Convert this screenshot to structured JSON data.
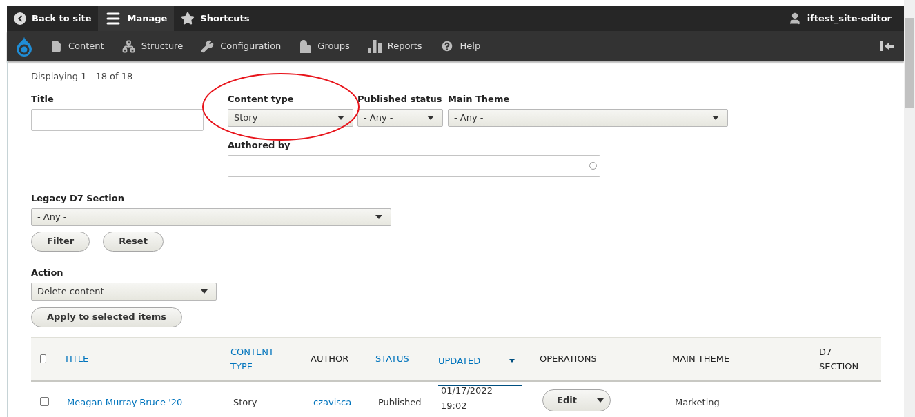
{
  "toolbar": {
    "tabs": [
      {
        "label": "Back to site",
        "kind": "back",
        "selected": false
      },
      {
        "label": "Manage",
        "kind": "menu",
        "selected": true
      },
      {
        "label": "Shortcuts",
        "kind": "star",
        "selected": false
      }
    ],
    "user": "iftest_site-editor"
  },
  "admin_menu": [
    {
      "label": "Content",
      "kind": "file"
    },
    {
      "label": "Structure",
      "kind": "structure"
    },
    {
      "label": "Configuration",
      "kind": "wrench"
    },
    {
      "label": "Groups",
      "kind": "groups"
    },
    {
      "label": "Reports",
      "kind": "reports"
    },
    {
      "label": "Help",
      "kind": "help"
    }
  ],
  "summary": "Displaying 1 - 18 of 18",
  "filters": {
    "title": {
      "label": "Title"
    },
    "content_type": {
      "label": "Content type",
      "value": "Story"
    },
    "published_status": {
      "label": "Published status",
      "value": "- Any -"
    },
    "main_theme": {
      "label": "Main Theme",
      "value": "- Any -"
    },
    "authored_by": {
      "label": "Authored by"
    },
    "legacy_section": {
      "label": "Legacy D7 Section",
      "value": "- Any -"
    },
    "buttons": [
      "Filter",
      "Reset"
    ]
  },
  "action": {
    "label": "Action",
    "value": "Delete content",
    "button": "Apply to selected items"
  },
  "table": {
    "select_all_checked": false,
    "columns": [
      {
        "label": "TITLE",
        "sortable": true,
        "sorted": false
      },
      {
        "label": "CONTENT TYPE",
        "sortable": true,
        "sorted": false
      },
      {
        "label": "AUTHOR",
        "sortable": false,
        "sorted": false
      },
      {
        "label": "STATUS",
        "sortable": true,
        "sorted": false
      },
      {
        "label": "UPDATED",
        "sortable": true,
        "sorted": true
      },
      {
        "label": "OPERATIONS",
        "sortable": false,
        "sorted": false
      },
      {
        "label": "MAIN THEME",
        "sortable": false,
        "sorted": false
      },
      {
        "label": "D7 SECTION",
        "sortable": false,
        "sorted": false
      }
    ],
    "rows": [
      {
        "checked": false,
        "title": "Meagan Murray-Bruce '20",
        "content_type": "Story",
        "author": "czavisca",
        "status": "Published",
        "updated": "01/17/2022 - 19:02",
        "operation": "Edit",
        "main_theme": "Marketing"
      }
    ]
  }
}
